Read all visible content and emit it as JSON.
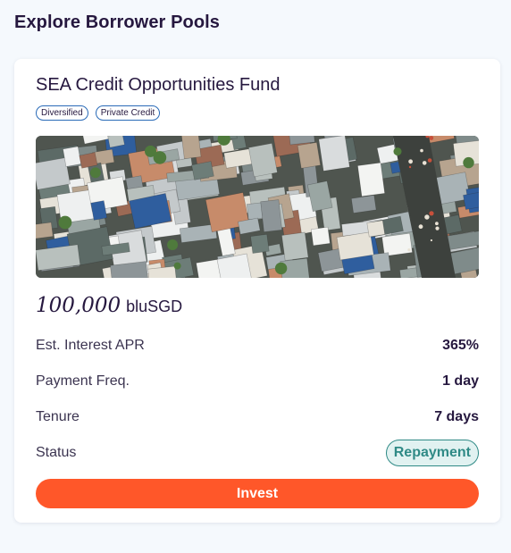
{
  "page": {
    "title": "Explore Borrower Pools"
  },
  "pool": {
    "name": "SEA Credit Opportunities Fund",
    "tags": [
      "Diversified",
      "Private Credit"
    ],
    "image_description": "aerial rooftops",
    "amount": "100,000",
    "currency": "bluSGD",
    "details": [
      {
        "label": "Est. Interest APR",
        "value": "365%"
      },
      {
        "label": "Payment Freq.",
        "value": "1 day"
      },
      {
        "label": "Tenure",
        "value": "7 days"
      }
    ],
    "status_label": "Status",
    "status_value": "Repayment",
    "invest_label": "Invest"
  },
  "colors": {
    "accent": "#ff5729",
    "status": "#2f8a86",
    "tag_border": "#2a6bb8",
    "title": "#26183f"
  }
}
